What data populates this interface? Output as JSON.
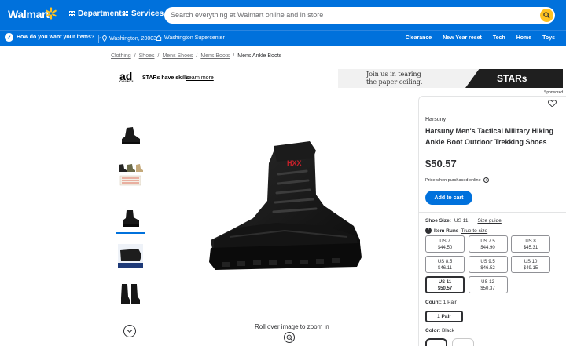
{
  "header": {
    "logo_text": "Walmart",
    "departments_label": "Departments",
    "services_label": "Services",
    "search_placeholder": "Search everything at Walmart online and in store",
    "brand_color": "#0071dc",
    "accent_color": "#ffc220"
  },
  "subnav": {
    "delivery_prompt": "How do you want your items?",
    "location": "Washington, 20003",
    "store": "Washington Supercenter",
    "links": [
      "Clearance",
      "New Year reset",
      "Tech",
      "Home",
      "Toys"
    ]
  },
  "breadcrumbs": [
    "Clothing",
    "Shoes",
    "Mens Shoes",
    "Mens Boots",
    "Mens Ankle Boots"
  ],
  "ad": {
    "logo_main": "ad",
    "logo_sub": "COUNCIL",
    "text": "STARs have skills",
    "learn_more": "Learn more",
    "banner_line1": "Join us in tearing",
    "banner_line2": "the paper ceiling.",
    "banner_brand": "STARs",
    "sponsored": "Sponsored"
  },
  "gallery": {
    "thumbnails": [
      "boot-side-view",
      "boots-color-options",
      "boot-angled-view",
      "boot-sole-closeup",
      "boots-pair-view"
    ],
    "selected_index": 2,
    "zoom_hint": "Roll over image to zoom in"
  },
  "product": {
    "brand": "Harsuny",
    "title": "Harsuny Men's Tactical Military Hiking Ankle Boot Outdoor Trekking Shoes",
    "price": "$50.57",
    "price_note": "Price when purchased online",
    "add_to_cart": "Add to cart",
    "size_label": "Shoe Size:",
    "size_value": "US 11",
    "size_guide": "Size guide",
    "item_runs": "Item Runs",
    "fit": "True to size",
    "sizes": [
      {
        "size": "US 7",
        "price": "$44.50"
      },
      {
        "size": "US 7.5",
        "price": "$44.90"
      },
      {
        "size": "US 8",
        "price": "$45.31"
      },
      {
        "size": "US 8.5",
        "price": "$46.11"
      },
      {
        "size": "US 9.5",
        "price": "$46.52"
      },
      {
        "size": "US 10",
        "price": "$49.15"
      },
      {
        "size": "US 11",
        "price": "$50.57"
      },
      {
        "size": "US 12",
        "price": "$50.37"
      }
    ],
    "selected_size_index": 6,
    "count_label": "Count:",
    "count_value": "1 Pair",
    "count_option": "1 Pair",
    "color_label": "Color:",
    "color_value": "Black"
  }
}
